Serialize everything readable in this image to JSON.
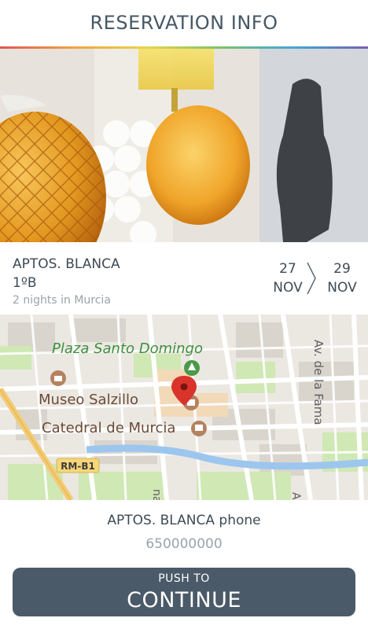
{
  "header": {
    "title": "RESERVATION INFO"
  },
  "reservation": {
    "name": "APTOS. BLANCA",
    "unit": "1ºB",
    "nights": "2 nights in Murcia",
    "check_in": {
      "day": "27",
      "month": "NOV"
    },
    "check_out": {
      "day": "29",
      "month": "NOV"
    }
  },
  "map": {
    "labels": {
      "plaza": "Plaza Santo Domingo",
      "museo": "Museo Salzillo",
      "catedral": "Catedral de Murcia",
      "avenida": "Av. de la Fama",
      "road": "RM-B1",
      "partial_left": "na",
      "partial_right": "A"
    }
  },
  "contact": {
    "phone_label": "APTOS. BLANCA phone",
    "phone_number": "650000000"
  },
  "action": {
    "push_label": "PUSH TO",
    "continue_label": "CONTINUE"
  },
  "colors": {
    "button": "#4a5a68",
    "text": "#3e4a55",
    "muted": "#9aa3aa",
    "map_pin": "#d9342b"
  }
}
